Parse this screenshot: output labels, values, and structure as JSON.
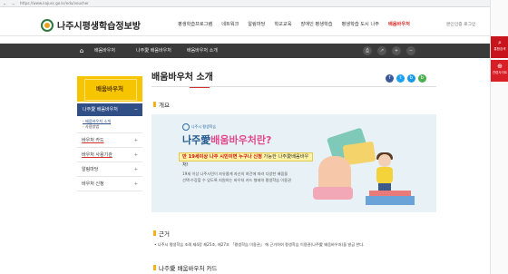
{
  "browser": {
    "url": "https://www.najusc.go.kr/edu/voucher"
  },
  "header": {
    "logo_text": "나주시평생학습정보방",
    "gnb": [
      "평생학습프로그램",
      "네트워크",
      "알림마당",
      "학교교육",
      "장애인 평생학습",
      "평생학습 도시 나주",
      "배움바우처"
    ],
    "active_index": 6,
    "util": "본인인증 로그인"
  },
  "side_quick": {
    "btn1": "통합검색",
    "btn2": "관련사이트"
  },
  "location": {
    "items": [
      "배움바우처",
      "나주愛 배움바우처",
      "배움바우처 소개"
    ]
  },
  "lnb": {
    "title": "배움바우처",
    "active": "나주愛 배움바우처",
    "subs": [
      "- 배움바우처 소개",
      "- 사용방법"
    ],
    "items": [
      "바우처 카드",
      "바우처 사용기관",
      "알림마당",
      "바우처 신청"
    ]
  },
  "content": {
    "title": "배움바우처 소개",
    "section1": "개요",
    "banner": {
      "brand": "나주시 평생학습",
      "title_a": "나주愛",
      "title_b": "배움바우처란?",
      "highlight_a": "만 19세이상 나주 시민이면 누구나 신청",
      "highlight_b": " 가능한 나주愛배움바우처!",
      "desc1": "19세 이상 나주시민이 자유롭게 자신의 여건에 따라 다양한 배움을",
      "desc2": "선택·수강할 수 있도록 지원하는 바우처 카드 형태의 평생학습 이용권"
    },
    "section2": "근거",
    "law": "• 나주시 평생학습 조례 제4장 제25조, 제27조 「평생학습 이용권」 에 근거하여 평생학습 이용권(나주愛 배움바우처)을 발급 한다.",
    "section3": "나주愛 배움바우처 카드"
  },
  "colors": {
    "accent": "#d6312c",
    "lnb_title": "#f7c400",
    "lnb_active": "#2f4f86",
    "quick": "#c8141c"
  }
}
